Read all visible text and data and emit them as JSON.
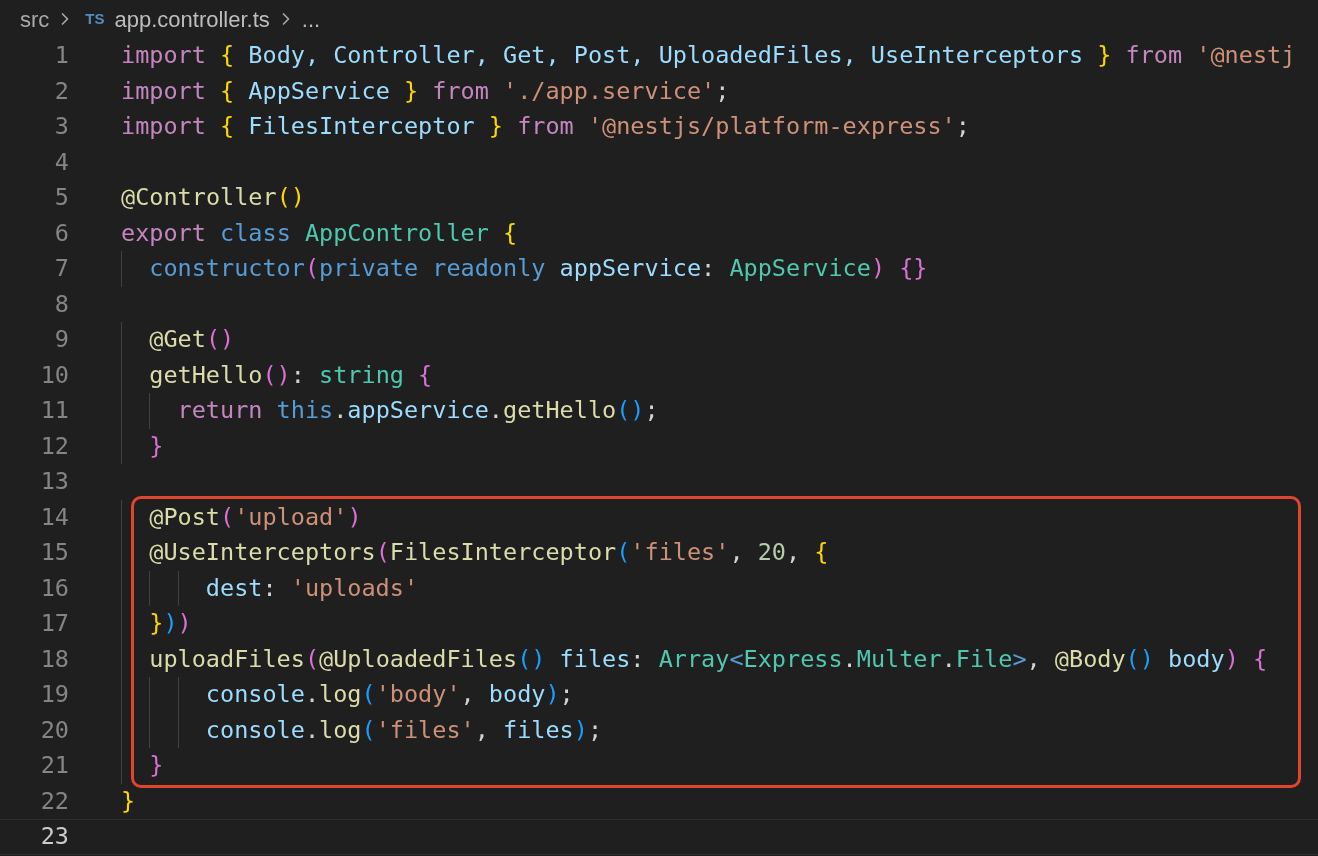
{
  "breadcrumb": {
    "folder": "src",
    "file_badge": "TS",
    "file": "app.controller.ts",
    "more": "..."
  },
  "blocks": [
    {
      "highlighted": false,
      "lines": [
        {
          "number": "1",
          "active": false,
          "tokens": [
            {
              "kind": "kw",
              "text": "import"
            },
            {
              "kind": "b1",
              "text": " {"
            },
            {
              "kind": "var",
              "text": " Body, Controller, Get, Post, UploadedFiles, UseInterceptors "
            },
            {
              "kind": "b1",
              "text": "}"
            },
            {
              "kind": "kw",
              "text": " from"
            },
            {
              "kind": "str",
              "text": " '@nestj"
            }
          ]
        },
        {
          "number": "2",
          "active": false,
          "tokens": [
            {
              "kind": "kw",
              "text": "import"
            },
            {
              "kind": "b1",
              "text": " {"
            },
            {
              "kind": "var",
              "text": " AppService "
            },
            {
              "kind": "b1",
              "text": "}"
            },
            {
              "kind": "kw",
              "text": " from"
            },
            {
              "kind": "str",
              "text": " './app.service'"
            },
            {
              "kind": "punc",
              "text": ";"
            }
          ]
        },
        {
          "number": "3",
          "active": false,
          "tokens": [
            {
              "kind": "kw",
              "text": "import"
            },
            {
              "kind": "b1",
              "text": " {"
            },
            {
              "kind": "var",
              "text": " FilesInterceptor "
            },
            {
              "kind": "b1",
              "text": "}"
            },
            {
              "kind": "kw",
              "text": " from"
            },
            {
              "kind": "str",
              "text": " '@nestjs/platform-express'"
            },
            {
              "kind": "punc",
              "text": ";"
            }
          ]
        },
        {
          "number": "4",
          "active": false
        },
        {
          "number": "5",
          "active": false,
          "tokens": [
            {
              "kind": "fn",
              "text": "@Controller"
            },
            {
              "kind": "b1",
              "text": "()"
            }
          ]
        },
        {
          "number": "6",
          "active": false,
          "tokens": [
            {
              "kind": "kw",
              "text": "export"
            },
            {
              "kind": "storage",
              "text": " class"
            },
            {
              "kind": "type",
              "text": " AppController"
            },
            {
              "kind": "b1",
              "text": " {"
            }
          ]
        },
        {
          "number": "7",
          "active": false,
          "tokens": [
            {
              "kind": "storage",
              "text": "  constructor"
            },
            {
              "kind": "b2",
              "text": "("
            },
            {
              "kind": "storage",
              "text": "private readonly"
            },
            {
              "kind": "var",
              "text": " appService"
            },
            {
              "kind": "punc",
              "text": ": "
            },
            {
              "kind": "type",
              "text": "AppService"
            },
            {
              "kind": "b2",
              "text": ")"
            },
            {
              "kind": "b2",
              "text": " {}"
            }
          ]
        },
        {
          "number": "8",
          "active": false
        },
        {
          "number": "9",
          "active": false,
          "tokens": [
            {
              "kind": "fn",
              "text": "  @Get"
            },
            {
              "kind": "b2",
              "text": "()"
            }
          ]
        },
        {
          "number": "10",
          "active": false,
          "tokens": [
            {
              "kind": "fn",
              "text": "  getHello"
            },
            {
              "kind": "b2",
              "text": "()"
            },
            {
              "kind": "punc",
              "text": ": "
            },
            {
              "kind": "type",
              "text": "string"
            },
            {
              "kind": "b2",
              "text": " {"
            }
          ]
        },
        {
          "number": "11",
          "active": false,
          "tokens": [
            {
              "kind": "kw",
              "text": "    return"
            },
            {
              "kind": "storage",
              "text": " this"
            },
            {
              "kind": "punc",
              "text": "."
            },
            {
              "kind": "var",
              "text": "appService"
            },
            {
              "kind": "punc",
              "text": "."
            },
            {
              "kind": "fn",
              "text": "getHello"
            },
            {
              "kind": "b3",
              "text": "()"
            },
            {
              "kind": "punc",
              "text": ";"
            }
          ]
        },
        {
          "number": "12",
          "active": false,
          "tokens": [
            {
              "kind": "b2",
              "text": "  }"
            }
          ]
        },
        {
          "number": "13",
          "active": false
        }
      ]
    },
    {
      "highlighted": true,
      "lines": [
        {
          "number": "14",
          "active": false,
          "tokens": [
            {
              "kind": "fn",
              "text": "  @Post"
            },
            {
              "kind": "b2",
              "text": "("
            },
            {
              "kind": "str",
              "text": "'upload'"
            },
            {
              "kind": "b2",
              "text": ")"
            }
          ]
        },
        {
          "number": "15",
          "active": false,
          "tokens": [
            {
              "kind": "fn",
              "text": "  @UseInterceptors"
            },
            {
              "kind": "b2",
              "text": "("
            },
            {
              "kind": "fn",
              "text": "FilesInterceptor"
            },
            {
              "kind": "b3",
              "text": "("
            },
            {
              "kind": "str",
              "text": "'files'"
            },
            {
              "kind": "punc",
              "text": ", "
            },
            {
              "kind": "num",
              "text": "20"
            },
            {
              "kind": "punc",
              "text": ", "
            },
            {
              "kind": "b1",
              "text": "{"
            }
          ]
        },
        {
          "number": "16",
          "active": false,
          "tokens": [
            {
              "kind": "var",
              "text": "      dest"
            },
            {
              "kind": "punc",
              "text": ": "
            },
            {
              "kind": "str",
              "text": "'uploads'"
            }
          ]
        },
        {
          "number": "17",
          "active": false,
          "tokens": [
            {
              "kind": "b1",
              "text": "  }"
            },
            {
              "kind": "b3",
              "text": ")"
            },
            {
              "kind": "b2",
              "text": ")"
            }
          ]
        },
        {
          "number": "18",
          "active": false,
          "tokens": [
            {
              "kind": "fn",
              "text": "  uploadFiles"
            },
            {
              "kind": "b2",
              "text": "("
            },
            {
              "kind": "fn",
              "text": "@UploadedFiles"
            },
            {
              "kind": "b3",
              "text": "()"
            },
            {
              "kind": "var",
              "text": " files"
            },
            {
              "kind": "punc",
              "text": ": "
            },
            {
              "kind": "type",
              "text": "Array"
            },
            {
              "kind": "storage",
              "text": "<"
            },
            {
              "kind": "type",
              "text": "Express"
            },
            {
              "kind": "punc",
              "text": "."
            },
            {
              "kind": "type",
              "text": "Multer"
            },
            {
              "kind": "punc",
              "text": "."
            },
            {
              "kind": "type",
              "text": "File"
            },
            {
              "kind": "storage",
              "text": ">"
            },
            {
              "kind": "punc",
              "text": ", "
            },
            {
              "kind": "fn",
              "text": "@Body"
            },
            {
              "kind": "b3",
              "text": "()"
            },
            {
              "kind": "var",
              "text": " body"
            },
            {
              "kind": "b2",
              "text": ")"
            },
            {
              "kind": "b2",
              "text": " {"
            }
          ]
        },
        {
          "number": "19",
          "active": false,
          "tokens": [
            {
              "kind": "var",
              "text": "      console"
            },
            {
              "kind": "punc",
              "text": "."
            },
            {
              "kind": "fn",
              "text": "log"
            },
            {
              "kind": "b3",
              "text": "("
            },
            {
              "kind": "str",
              "text": "'body'"
            },
            {
              "kind": "punc",
              "text": ", "
            },
            {
              "kind": "var",
              "text": "body"
            },
            {
              "kind": "b3",
              "text": ")"
            },
            {
              "kind": "punc",
              "text": ";"
            }
          ]
        },
        {
          "number": "20",
          "active": false,
          "tokens": [
            {
              "kind": "var",
              "text": "      console"
            },
            {
              "kind": "punc",
              "text": "."
            },
            {
              "kind": "fn",
              "text": "log"
            },
            {
              "kind": "b3",
              "text": "("
            },
            {
              "kind": "str",
              "text": "'files'"
            },
            {
              "kind": "punc",
              "text": ", "
            },
            {
              "kind": "var",
              "text": "files"
            },
            {
              "kind": "b3",
              "text": ")"
            },
            {
              "kind": "punc",
              "text": ";"
            }
          ]
        },
        {
          "number": "21",
          "active": false,
          "tokens": [
            {
              "kind": "b2",
              "text": "  }"
            }
          ]
        }
      ]
    },
    {
      "highlighted": false,
      "lines": [
        {
          "number": "22",
          "active": false,
          "tokens": [
            {
              "kind": "b1",
              "text": "}"
            }
          ]
        },
        {
          "number": "23",
          "active": true
        }
      ]
    }
  ]
}
